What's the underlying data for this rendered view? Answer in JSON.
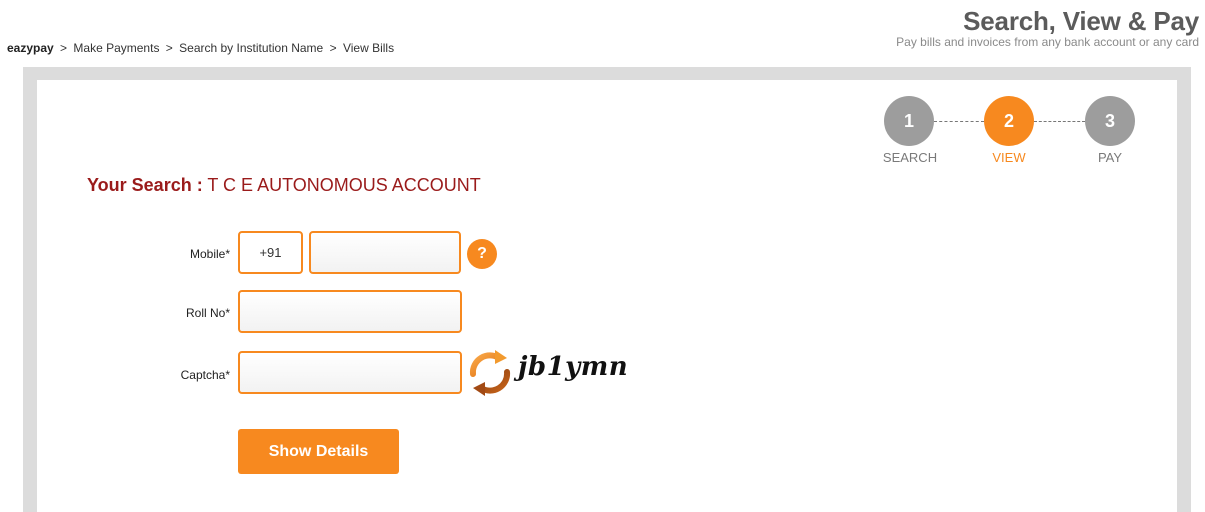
{
  "breadcrumb": {
    "home": "eazypay",
    "separator": ">",
    "items": [
      "Make Payments",
      "Search by Institution Name",
      "View Bills"
    ]
  },
  "header": {
    "title": "Search, View & Pay",
    "subtitle": "Pay bills and invoices from any bank account or any card"
  },
  "stepper": {
    "steps": [
      {
        "number": "1",
        "label": "SEARCH",
        "state": "done"
      },
      {
        "number": "2",
        "label": "VIEW",
        "state": "active"
      },
      {
        "number": "3",
        "label": "PAY",
        "state": "todo"
      }
    ]
  },
  "search": {
    "label": "Your Search :",
    "value": "T C E AUTONOMOUS ACCOUNT"
  },
  "form": {
    "mobile_label": "Mobile*",
    "mobile_prefix": "+91",
    "mobile_value": "",
    "help_symbol": "?",
    "rollno_label": "Roll No*",
    "rollno_value": "",
    "captcha_label": "Captcha*",
    "captcha_value": "",
    "captcha_text": "jb1ymn",
    "submit_label": "Show Details"
  },
  "colors": {
    "accent": "#f7891f",
    "heading": "#9a1b1b",
    "step_inactive": "#9d9d9d",
    "panel_border": "#dcdcdc"
  },
  "icons": {
    "help": "question-mark-icon",
    "refresh": "refresh-captcha-icon"
  }
}
